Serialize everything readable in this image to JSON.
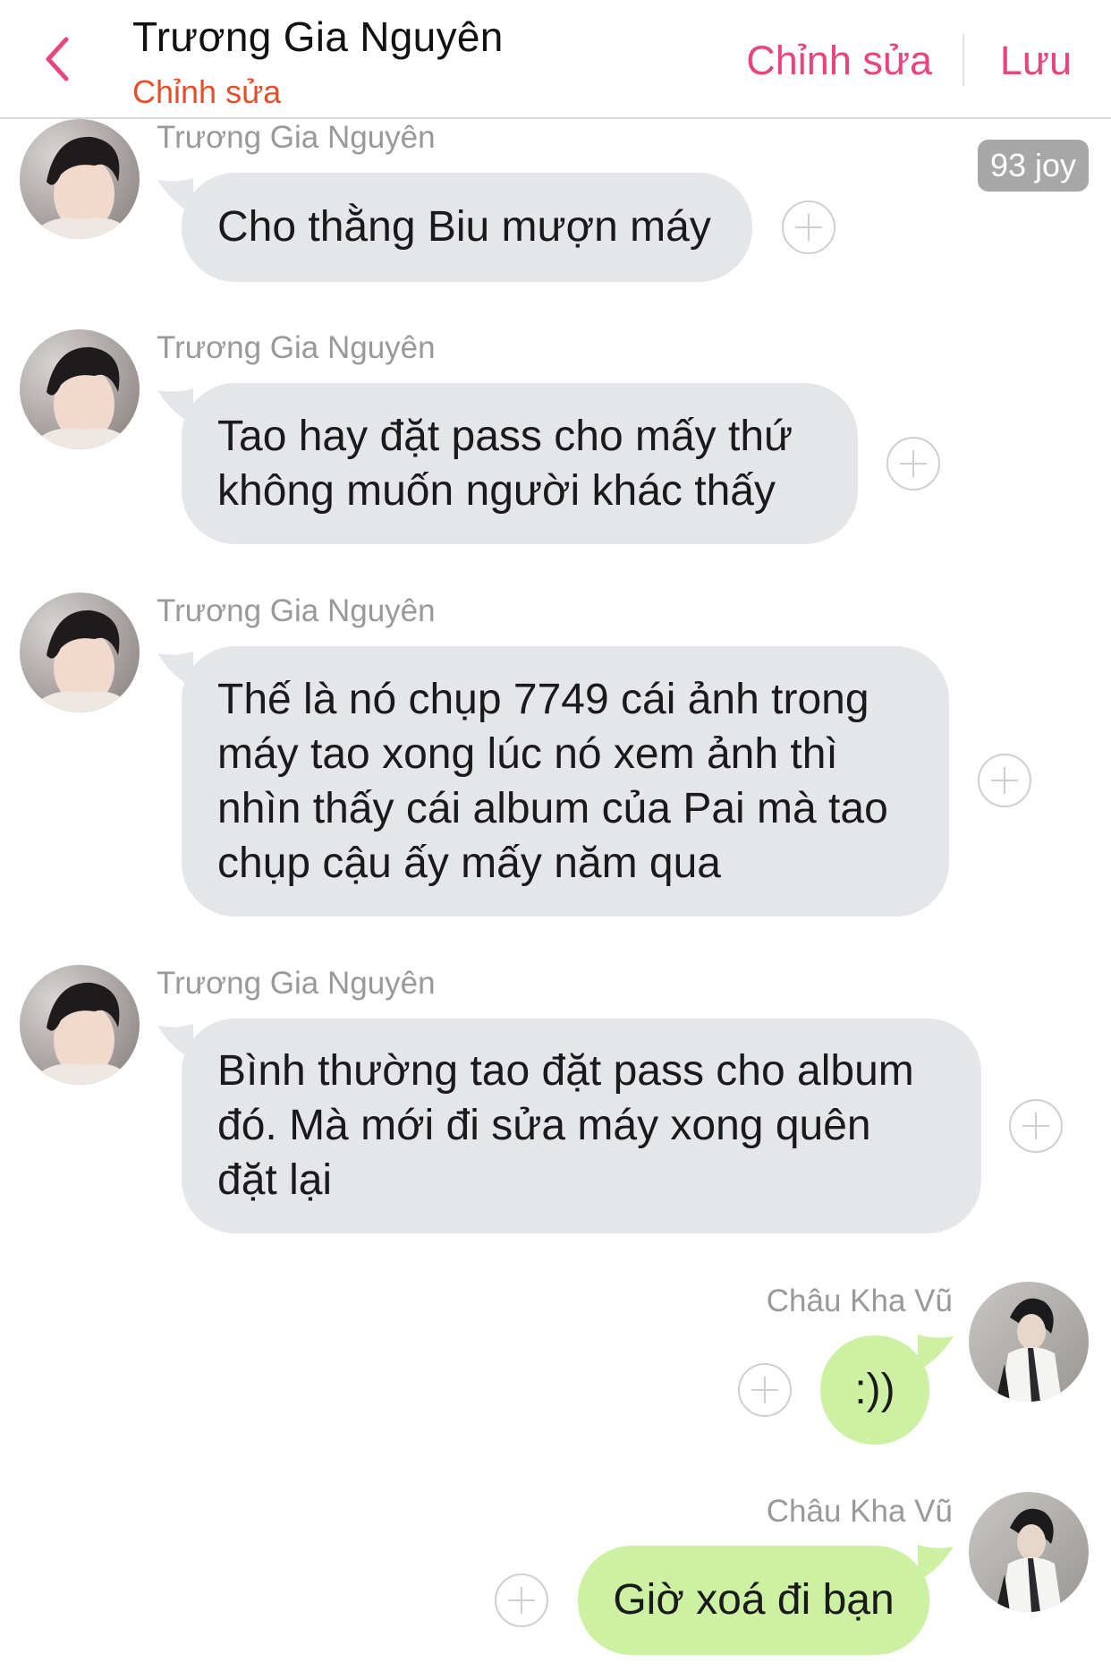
{
  "header": {
    "back_icon": "chevron-left-icon",
    "title": "Trương Gia Nguyên",
    "subtitle": "Chỉnh sửa",
    "edit_label": "Chỉnh sửa",
    "save_label": "Lưu",
    "accent_color": "#e8457a"
  },
  "badge": {
    "label": "93 joy"
  },
  "messages": [
    {
      "side": "incoming",
      "sender": "Trương Gia Nguyên",
      "lines": [
        "Cho thằng Biu mượn máy"
      ]
    },
    {
      "side": "incoming",
      "sender": "Trương Gia Nguyên",
      "lines": [
        "Tao hay đặt pass cho mấy thứ",
        "không muốn người khác thấy"
      ]
    },
    {
      "side": "incoming",
      "sender": "Trương Gia Nguyên",
      "lines": [
        "Thế là nó chụp 7749 cái ảnh trong",
        "máy tao xong lúc nó xem ảnh thì",
        "nhìn thấy cái album của Pai mà tao",
        "chụp cậu ấy mấy năm qua"
      ]
    },
    {
      "side": "incoming",
      "sender": "Trương Gia Nguyên",
      "lines": [
        "Bình thường tao đặt pass cho album",
        "đó. Mà mới đi sửa máy xong quên",
        "đặt lại"
      ]
    },
    {
      "side": "outgoing",
      "sender": "Châu Kha Vũ",
      "lines": [
        ":))"
      ]
    },
    {
      "side": "outgoing",
      "sender": "Châu Kha Vũ",
      "lines": [
        "Giờ xoá đi bạn"
      ]
    }
  ],
  "colors": {
    "incoming_bubble": "#e4e6ea",
    "outgoing_bubble": "#cdf1a3",
    "sender_text": "#999999"
  }
}
